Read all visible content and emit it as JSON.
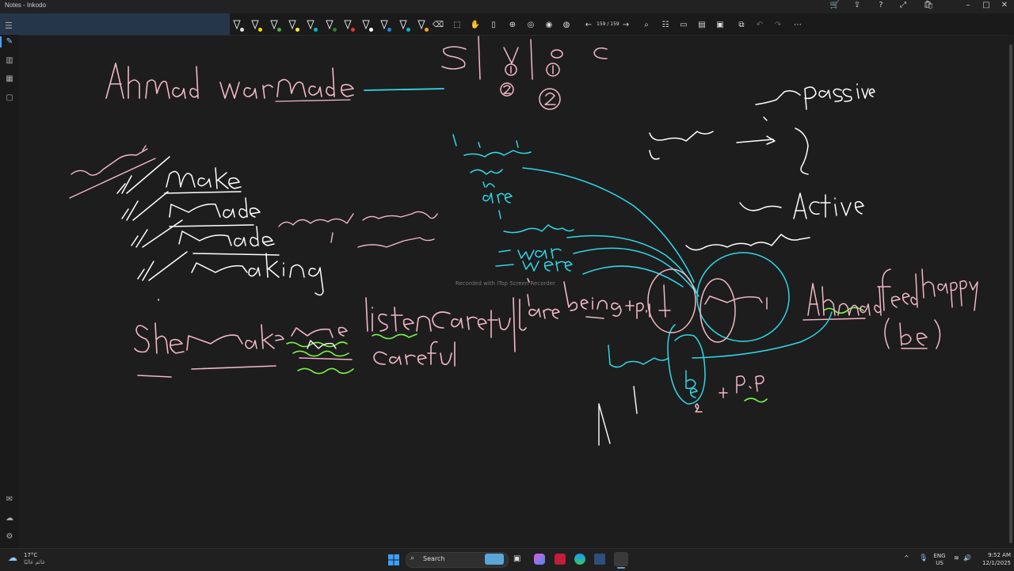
{
  "window": {
    "title": "Notes - Inkodo"
  },
  "toolbar": {
    "page_counter": "159 / 159",
    "pens": [
      {
        "name": "pen-1",
        "color": "#e0e0e0"
      },
      {
        "name": "pen-2",
        "color": "#ffd700"
      },
      {
        "name": "pen-3",
        "color": "#4caf50"
      },
      {
        "name": "pen-4",
        "color": "#ffeb3b"
      },
      {
        "name": "pen-5",
        "color": "#00bcd4"
      },
      {
        "name": "pen-6",
        "color": "#2e7d32"
      },
      {
        "name": "pen-7",
        "color": "#e53935"
      },
      {
        "name": "pen-8",
        "color": "#ffffff"
      },
      {
        "name": "pen-9",
        "color": "#1e88e5"
      },
      {
        "name": "pen-10",
        "color": "#00bcd4"
      },
      {
        "name": "pen-11",
        "color": "#f5a623"
      }
    ]
  },
  "note": {
    "watermark": "Recorded with iTop Screen Recorder"
  },
  "taskbar": {
    "weather_temp": "17°C",
    "weather_desc": "غائم غالبًا",
    "search_label": "Search",
    "lang_top": "ENG",
    "lang_bottom": "US",
    "time": "9:52 AM",
    "date": "12/1/2025"
  },
  "colors": {
    "pink": "#f2b8c6",
    "white": "#ffffff",
    "cyan": "#30d7e6",
    "green": "#7cf04a"
  }
}
